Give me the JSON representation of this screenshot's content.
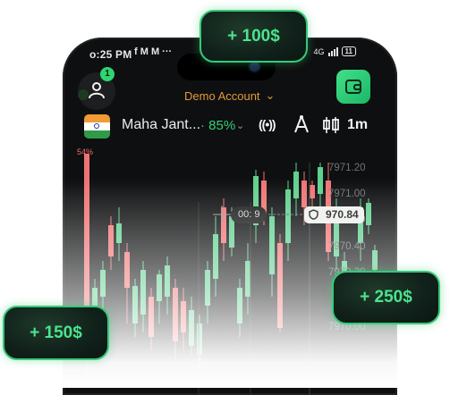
{
  "status_bar": {
    "time": "o:25 PM",
    "notification_icons": "f M M ···",
    "network": "4G",
    "battery": "11"
  },
  "header": {
    "notification_count": "1",
    "account_label": "Demo Account",
    "account_chevron": "⌄"
  },
  "asset_bar": {
    "asset_name": "Maha Jant...",
    "payout": "· 85%",
    "chevron": "⌄",
    "signal_icon": "((•))",
    "timeframe": "1m"
  },
  "chart": {
    "left_percent": "54%",
    "price_labels": [
      "7971.20",
      "7971.00",
      "7970.60",
      "7970.40",
      "7970.20",
      "7970.00"
    ],
    "current_price": "970.84",
    "timer": "00: 9",
    "colors": {
      "up": "#5fd08f",
      "down": "#f07373",
      "accent": "#34d177"
    }
  },
  "bonuses": {
    "top": "+ 100$",
    "right": "+ 250$",
    "left": "+ 150$"
  }
}
